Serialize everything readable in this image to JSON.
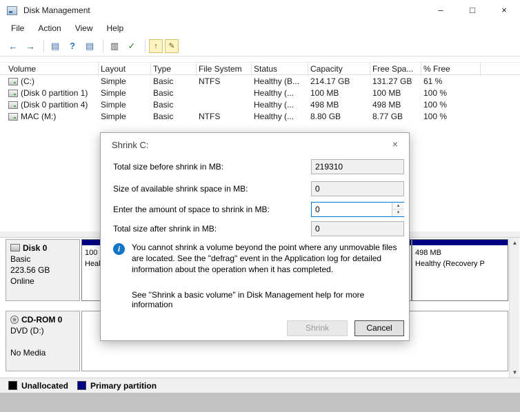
{
  "window": {
    "title": "Disk Management",
    "minimize": "–",
    "maximize": "□",
    "close": "×"
  },
  "menu": {
    "items": [
      "File",
      "Action",
      "View",
      "Help"
    ]
  },
  "toolbar": {
    "icons": [
      {
        "name": "back",
        "glyph": "←"
      },
      {
        "name": "forward",
        "glyph": "→"
      },
      {
        "name": "show-console-tree",
        "glyph": "▤"
      },
      {
        "name": "help",
        "glyph": "?"
      },
      {
        "name": "properties",
        "glyph": "▤"
      },
      {
        "name": "action-pane",
        "glyph": "▥"
      },
      {
        "name": "check-list",
        "glyph": "✓"
      },
      {
        "name": "up-folder",
        "glyph": "↑"
      },
      {
        "name": "edit",
        "glyph": "✎"
      }
    ]
  },
  "volume_table": {
    "columns": [
      "Volume",
      "Layout",
      "Type",
      "File System",
      "Status",
      "Capacity",
      "Free Spa...",
      "% Free"
    ],
    "rows": [
      {
        "volume": "(C:)",
        "layout": "Simple",
        "type": "Basic",
        "file_system": "NTFS",
        "status": "Healthy (B...",
        "capacity": "214.17 GB",
        "free_space": "131.27 GB",
        "pct_free": "61 %"
      },
      {
        "volume": "(Disk 0 partition 1)",
        "layout": "Simple",
        "type": "Basic",
        "file_system": "",
        "status": "Healthy (...",
        "capacity": "100 MB",
        "free_space": "100 MB",
        "pct_free": "100 %"
      },
      {
        "volume": "(Disk 0 partition 4)",
        "layout": "Simple",
        "type": "Basic",
        "file_system": "",
        "status": "Healthy (...",
        "capacity": "498 MB",
        "free_space": "498 MB",
        "pct_free": "100 %"
      },
      {
        "volume": "MAC (M:)",
        "layout": "Simple",
        "type": "Basic",
        "file_system": "NTFS",
        "status": "Healthy (...",
        "capacity": "8.80 GB",
        "free_space": "8.77 GB",
        "pct_free": "100 %"
      }
    ]
  },
  "dialog": {
    "title": "Shrink C:",
    "close": "×",
    "fields": [
      {
        "label": "Total size before shrink in MB:",
        "value": "219310"
      },
      {
        "label": "Size of available shrink space in MB:",
        "value": "0"
      },
      {
        "label": "Enter the amount of space to shrink in MB:",
        "value": "0"
      },
      {
        "label": "Total size after shrink in MB:",
        "value": "0"
      }
    ],
    "info_text": "You cannot shrink a volume beyond the point where any unmovable files are located. See the \"defrag\" event in the Application log for detailed information about the operation when it has completed.",
    "help_text": "See \"Shrink a basic volume\" in Disk Management help for more information",
    "buttons": {
      "shrink": "Shrink",
      "cancel": "Cancel"
    }
  },
  "disk0": {
    "name": "Disk 0",
    "type": "Basic",
    "size": "223.56 GB",
    "status": "Online",
    "partitions": [
      {
        "size": "100 MB",
        "status": "Healthy ("
      },
      {
        "size": "",
        "status": ""
      },
      {
        "size": "498 MB",
        "status": "Healthy (Recovery P"
      }
    ]
  },
  "cdrom": {
    "name": "CD-ROM 0",
    "drive": "DVD (D:)",
    "media": "No Media"
  },
  "legend": {
    "items": [
      {
        "label": "Unallocated",
        "color": "#000000"
      },
      {
        "label": "Primary partition",
        "color": "#000082"
      }
    ]
  },
  "colors": {
    "primary_partition": "#000082",
    "focus_border": "#0078d7"
  }
}
